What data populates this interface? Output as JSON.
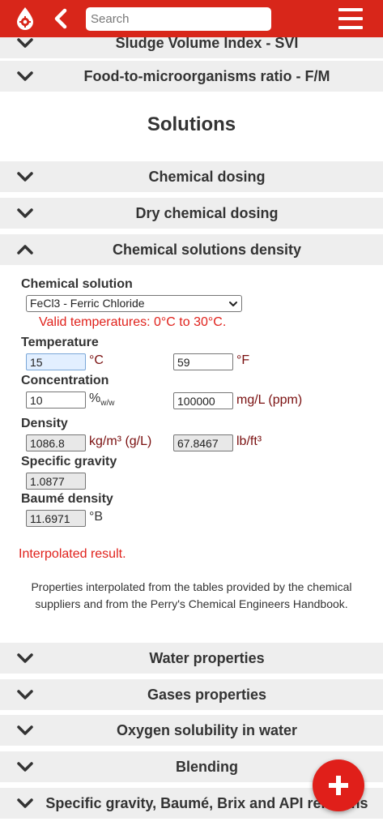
{
  "header": {
    "search_placeholder": "Search",
    "accent_color": "#d8261a"
  },
  "accordion_top": [
    {
      "title": "Sludge Volume Index - SVI",
      "state": "collapsed"
    },
    {
      "title": "Food-to-microorganisms ratio - F/M",
      "state": "collapsed"
    }
  ],
  "section": {
    "title": "Solutions"
  },
  "solutions_items": [
    {
      "title": "Chemical dosing",
      "state": "collapsed"
    },
    {
      "title": "Dry chemical dosing",
      "state": "collapsed"
    },
    {
      "title": "Chemical solutions density",
      "state": "expanded"
    }
  ],
  "form": {
    "chemical_label": "Chemical solution",
    "chemical_selected": "FeCl3 - Ferric Chloride",
    "valid_temps": "Valid temperatures: 0°C to 30°C.",
    "temperature_label": "Temperature",
    "temp_c": "15",
    "unit_c": "°C",
    "temp_f": "59",
    "unit_f": "°F",
    "concentration_label": "Concentration",
    "conc_pct": "10",
    "unit_pct": "%",
    "unit_pct_sub": "w/w",
    "conc_mgl": "100000",
    "unit_mgl": "mg/L (ppm)",
    "density_label": "Density",
    "density_kgm3": "1086.8",
    "unit_kgm3": "kg/m³ (g/L)",
    "density_lbft3": "67.8467",
    "unit_lbft3": "lb/ft³",
    "sg_label": "Specific gravity",
    "sg_value": "1.0877",
    "baume_label": "Baumé density",
    "baume_value": "11.6971",
    "unit_baume": "°B",
    "interpolated": "Interpolated result.",
    "note": "Properties interpolated from the tables provided by the chemical suppliers and from the Perry's Chemical Engineers Handbook."
  },
  "accordion_bottom": [
    {
      "title": "Water properties",
      "state": "collapsed"
    },
    {
      "title": "Gases properties",
      "state": "collapsed"
    },
    {
      "title": "Oxygen solubility in water",
      "state": "collapsed"
    },
    {
      "title": "Blending",
      "state": "collapsed"
    },
    {
      "title": "Specific gravity, Baumé, Brix and API relations",
      "state": "collapsed"
    }
  ],
  "fab": {
    "icon": "plus-icon"
  }
}
